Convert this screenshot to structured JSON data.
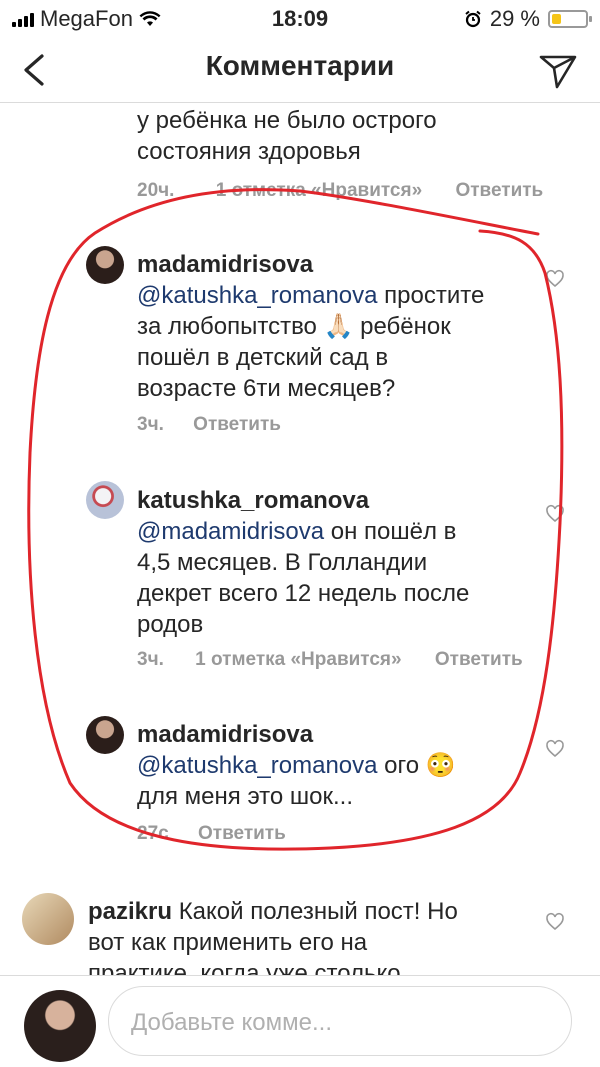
{
  "status": {
    "carrier": "MegaFon",
    "time": "18:09",
    "battery": "29 %"
  },
  "header": {
    "title": "Комментарии"
  },
  "comments": [
    {
      "text": "у ребёнка не было острого состояния здоровья",
      "line1": "у ребёнка не было острого",
      "line2": "состояния здоровья",
      "time": "20ч.",
      "likes": "1 отметка «Нравится»",
      "reply": "Ответить"
    },
    {
      "user": "madamidrisova",
      "mention": "@katushka_romanova",
      "l1": " простите",
      "l2": "за любопытство 🙏🏻 ребёнок",
      "l3": "пошёл в детский сад в",
      "l4": "возрасте 6ти месяцев?",
      "time": "3ч.",
      "reply": "Ответить"
    },
    {
      "user": "katushka_romanova",
      "mention": "@madamidrisova",
      "l1": " он пошёл в",
      "l2": "4,5 месяцев. В Голландии",
      "l3": "декрет всего 12 недель после",
      "l4": "родов",
      "time": "3ч.",
      "likes": "1 отметка «Нравится»",
      "reply": "Ответить"
    },
    {
      "user": "madamidrisova",
      "mention": "@katushka_romanova",
      "l1": " ого 😳",
      "l2": "для меня это шок...",
      "time": "27с",
      "reply": "Ответить"
    },
    {
      "user": "pazikru",
      "l1": " Какой полезный пост! Но",
      "l2": "вот как применить его на",
      "l3": "практике, когда уже столько"
    }
  ],
  "composer": {
    "placeholder": "Добавьте комме..."
  }
}
